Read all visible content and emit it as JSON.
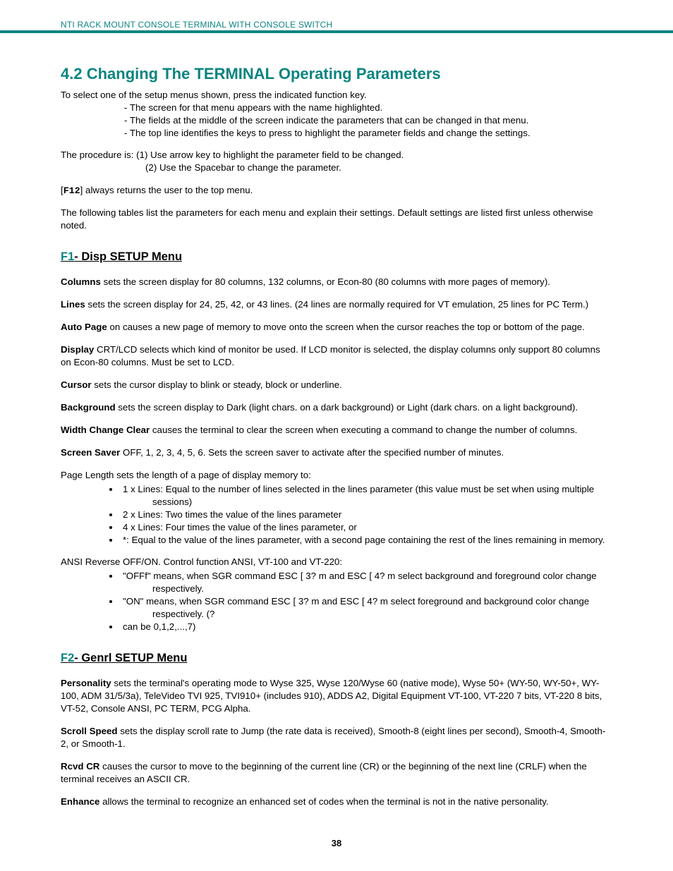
{
  "header": "NTI RACK MOUNT CONSOLE TERMINAL WITH CONSOLE SWITCH",
  "page_number": "38",
  "section_title": "4.2 Changing The TERMINAL Operating Parameters",
  "intro": {
    "lead": "To select one of the setup menus shown, press the indicated function key.",
    "items": [
      "- The screen for that menu appears with the name highlighted.",
      "- The fields at the middle of the screen indicate the parameters that can be changed in that menu.",
      "- The top line identifies the keys to press to highlight the parameter fields and change the settings."
    ],
    "procedure_1": "The procedure is: (1) Use arrow key to highlight the parameter field to be changed.",
    "procedure_2": "(2) Use the Spacebar to change the parameter.",
    "f12_pre": "[",
    "f12_key": "F12",
    "f12_post": "] always returns the user to the top menu.",
    "following": "The following tables list the parameters for each menu and explain their settings. Default settings are listed first unless otherwise noted."
  },
  "f1": {
    "key": "F1",
    "title": "-  Disp SETUP Menu",
    "columns_t": "Columns",
    "columns_d": " sets the screen display for 80 columns, 132 columns, or Econ-80 (80 columns with more pages of memory).",
    "lines_t": "Lines",
    "lines_d": " sets the screen display for 24, 25, 42, or 43 lines. (24 lines are normally required for VT emulation, 25 lines for PC Term.)",
    "autopage_t": "Auto Page",
    "autopage_d": " on causes a new page of memory to move onto the screen when the cursor reaches the top or bottom of the page.",
    "display_t": "Display",
    "display_d": " CRT/LCD selects which kind of monitor be used. If LCD monitor is selected, the display columns only support 80 columns on Econ-80 columns. Must be set to LCD.",
    "cursor_t": "Cursor",
    "cursor_d": " sets the cursor display to blink or steady, block or underline.",
    "background_t": "Background",
    "background_d": " sets the screen display to Dark (light chars. on a dark background) or Light (dark chars. on a light background).",
    "wcc_t": "Width Change Clear",
    "wcc_d": " causes the terminal to clear the screen when executing a command to change the number of columns.",
    "ssaver_t": "Screen Saver",
    "ssaver_d": " OFF, 1, 2, 3, 4, 5, 6. Sets the screen saver to activate after the specified number of minutes.",
    "plen_t": "Page Length",
    "plen_d": " sets the length of a page of display memory to:",
    "plen_items": [
      {
        "head": "1 x Lines: Equal to the number of lines selected in the lines parameter (this value must be set when using multiple",
        "wrap": "sessions)"
      },
      {
        "head": "2 x Lines: Two times the value of the lines parameter",
        "wrap": ""
      },
      {
        "head": "4 x Lines: Four times the value of the lines parameter, or",
        "wrap": ""
      },
      {
        "head": "*: Equal to the value of the lines parameter, with a second page containing the rest of the lines remaining in memory.",
        "wrap": ""
      }
    ],
    "ansi_t": "ANSI Reverse",
    "ansi_d": " OFF/ON. Control function ANSI, VT-100 and VT-220:",
    "ansi_items": [
      {
        "head": "\"OFFf\" means, when SGR command ESC [ 3? m and ESC [ 4? m select background and foreground color change",
        "wrap": "respectively."
      },
      {
        "head": "\"ON\" means, when SGR command ESC [ 3? m and ESC [ 4? m select foreground and background color change",
        "wrap": "respectively. (?"
      },
      {
        "head": "can be 0,1,2,...,7)",
        "wrap": ""
      }
    ]
  },
  "f2": {
    "key": "F2",
    "title": "- Genrl SETUP Menu",
    "pers_t": "Personality",
    "pers_d": " sets the terminal's operating mode to Wyse 325, Wyse 120/Wyse 60 (native mode), Wyse 50+ (WY-50, WY-50+, WY-100, ADM 31/5/3a), TeleVideo TVI 925, TVI910+ (includes 910), ADDS A2, Digital Equipment VT-100, VT-220 7 bits, VT-220 8 bits, VT-52, Console ANSI, PC TERM, PCG Alpha.",
    "scroll_t": "Scroll Speed",
    "scroll_d": " sets the display scroll rate to Jump (the rate data is received), Smooth-8 (eight lines per second), Smooth-4, Smooth-2, or Smooth-1.",
    "rcvd_t": "Rcvd CR",
    "rcvd_d": " causes the cursor to move to the beginning of the current line (CR) or the beginning of the next line (CRLF) when the terminal receives an ASCII CR.",
    "enh_t": "Enhance",
    "enh_d": " allows the terminal to recognize an enhanced set of codes when the terminal is not in the native personality."
  }
}
